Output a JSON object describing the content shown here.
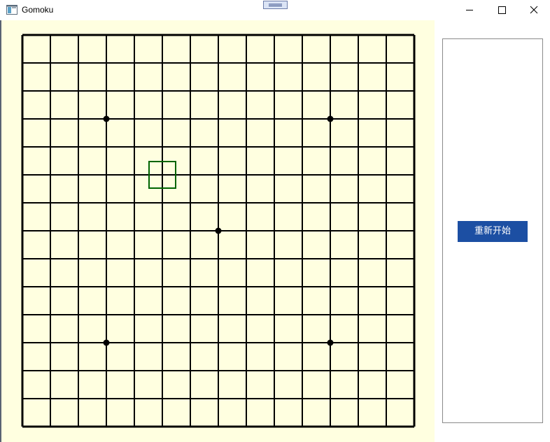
{
  "window": {
    "title": "Gomoku",
    "icon": "app-window-icon",
    "controls": {
      "minimize_icon": "minimize-icon",
      "maximize_icon": "maximize-icon",
      "close_icon": "close-icon"
    }
  },
  "board": {
    "size": 15,
    "background_color": "#ffffe0",
    "line_color": "#000000",
    "star_points": [
      [
        3,
        3
      ],
      [
        11,
        3
      ],
      [
        7,
        7
      ],
      [
        3,
        11
      ],
      [
        11,
        11
      ]
    ],
    "stones": [],
    "cursor": {
      "col": 5,
      "row": 5,
      "color": "#006400"
    }
  },
  "side_panel": {
    "restart_label": "重新开始",
    "restart_color": "#1c4fa3"
  }
}
